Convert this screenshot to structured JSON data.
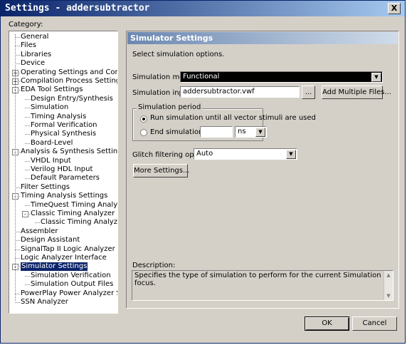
{
  "window": {
    "title": "Settings - addersubtractor",
    "close_glyph": "X"
  },
  "category_label": "Category:",
  "tree": [
    {
      "label": "General",
      "level": 0
    },
    {
      "label": "Files",
      "level": 0
    },
    {
      "label": "Libraries",
      "level": 0
    },
    {
      "label": "Device",
      "level": 0
    },
    {
      "label": "Operating Settings and Conditions",
      "level": 0,
      "expander": "+"
    },
    {
      "label": "Compilation Process Settings",
      "level": 0,
      "expander": "+"
    },
    {
      "label": "EDA Tool Settings",
      "level": 0,
      "expander": "-"
    },
    {
      "label": "Design Entry/Synthesis",
      "level": 1
    },
    {
      "label": "Simulation",
      "level": 1
    },
    {
      "label": "Timing Analysis",
      "level": 1
    },
    {
      "label": "Formal Verification",
      "level": 1
    },
    {
      "label": "Physical Synthesis",
      "level": 1
    },
    {
      "label": "Board-Level",
      "level": 1
    },
    {
      "label": "Analysis & Synthesis Settings",
      "level": 0,
      "expander": "-"
    },
    {
      "label": "VHDL Input",
      "level": 1
    },
    {
      "label": "Verilog HDL Input",
      "level": 1
    },
    {
      "label": "Default Parameters",
      "level": 1
    },
    {
      "label": "Filter Settings",
      "level": 0
    },
    {
      "label": "Timing Analysis Settings",
      "level": 0,
      "expander": "-"
    },
    {
      "label": "TimeQuest Timing Analyzer",
      "level": 1
    },
    {
      "label": "Classic Timing Analyzer Settings",
      "level": 1,
      "expander": "-"
    },
    {
      "label": "Classic Timing Analyzer Repor",
      "level": 2
    },
    {
      "label": "Assembler",
      "level": 0
    },
    {
      "label": "Design Assistant",
      "level": 0
    },
    {
      "label": "SignalTap II Logic Analyzer",
      "level": 0
    },
    {
      "label": "Logic Analyzer Interface",
      "level": 0
    },
    {
      "label": "Simulator Settings",
      "level": 0,
      "expander": "-",
      "selected": true
    },
    {
      "label": "Simulation Verification",
      "level": 1
    },
    {
      "label": "Simulation Output Files",
      "level": 1
    },
    {
      "label": "PowerPlay Power Analyzer Settings",
      "level": 0
    },
    {
      "label": "SSN Analyzer",
      "level": 0
    }
  ],
  "panel": {
    "title": "Simulator Settings",
    "intro": "Select simulation options.",
    "mode_label": "Simulation mode:",
    "mode_value": "Functional",
    "input_label": "Simulation input:",
    "input_value": "addersubtractor.vwf",
    "browse_label": "...",
    "add_files_label": "Add Multiple Files...",
    "period_group": "Simulation period",
    "radio_run_label": "Run simulation until all vector stimuli are used",
    "radio_end_label": "End simulation at:",
    "end_value": "",
    "end_unit": "ns",
    "glitch_label": "Glitch filtering options:",
    "glitch_value": "Auto",
    "more_settings_label": "More Settings...",
    "description_label": "Description:",
    "description_text": "Specifies the type of simulation to perform for the current Simulation focus."
  },
  "buttons": {
    "ok": "OK",
    "cancel": "Cancel"
  },
  "icons": {
    "dropdown": "chevron-down-icon",
    "radio_selected": "radio-selected",
    "scroll_up": "up-arrow-icon",
    "scroll_down": "down-arrow-icon"
  },
  "colors": {
    "titlebar_start": "#0a246a",
    "titlebar_end": "#a6caf0",
    "panel_header": "#6b87b0",
    "selection": "#0a246a",
    "face": "#d4d0c8"
  }
}
